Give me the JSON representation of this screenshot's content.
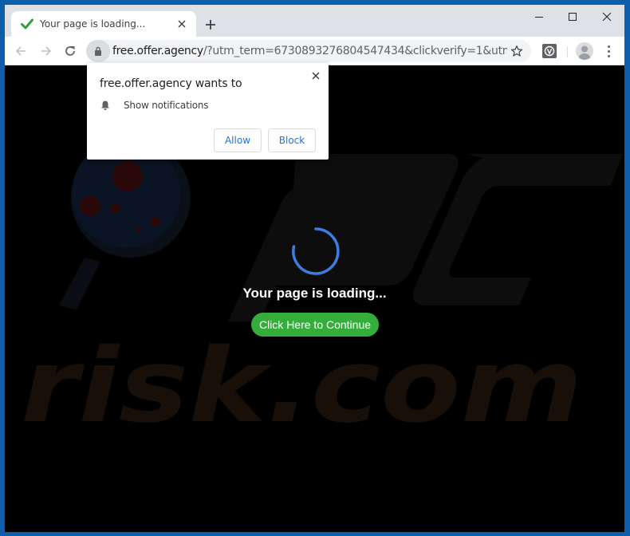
{
  "browser": {
    "tab": {
      "title": "Your page is loading...",
      "status_icon": "check-icon",
      "close_icon": "close-icon"
    },
    "new_tab_label": "+",
    "window_controls": {
      "minimize": "minimize-icon",
      "maximize": "maximize-icon",
      "close": "close-icon"
    },
    "toolbar": {
      "back_icon": "arrow-left-icon",
      "forward_icon": "arrow-right-icon",
      "reload_icon": "reload-icon",
      "url_host": "free.offer.agency",
      "url_rest": "/?utm_term=6730893276804547434&clickverify=1&utm_content...",
      "bookmark_icon": "star-icon",
      "extension_icon": "extension-v-icon",
      "profile_icon": "avatar-icon",
      "menu_icon": "more-vert-icon"
    }
  },
  "permission_popup": {
    "title": "free.offer.agency wants to",
    "permission_label": "Show notifications",
    "permission_icon": "bell-icon",
    "allow_label": "Allow",
    "block_label": "Block"
  },
  "page": {
    "loading_text": "Your page is loading...",
    "continue_label": "Click Here to Continue",
    "watermark_text": "risk.com",
    "colors": {
      "spinner": "#3b7de0",
      "button": "#35ad3b",
      "frame": "#0d5fae"
    }
  }
}
